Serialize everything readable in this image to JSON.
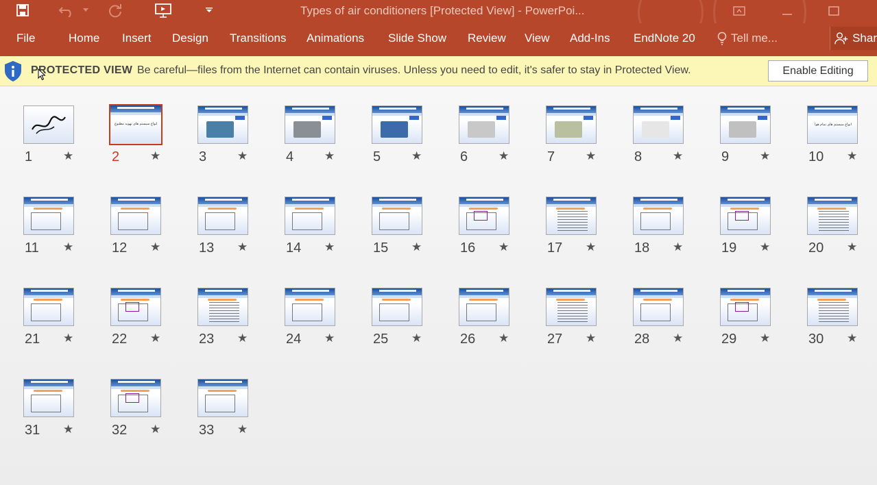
{
  "titlebar": {
    "title": "Types of air conditioners [Protected View] - PowerPoi...",
    "icons": [
      "save-icon",
      "undo-icon",
      "undo-dropdown-icon",
      "redo-icon",
      "from-beginning-icon",
      "customize-qat-icon",
      "restore-ribbon-icon",
      "minimize-icon",
      "maximize-icon"
    ]
  },
  "ribbon": {
    "tabs": [
      "File",
      "Home",
      "Insert",
      "Design",
      "Transitions",
      "Animations",
      "Slide Show",
      "Review",
      "View",
      "Add-Ins",
      "EndNote 20"
    ],
    "tell_me": "Tell me...",
    "share": "Shar"
  },
  "protected_view": {
    "title": "PROTECTED VIEW",
    "message": "Be careful—files from the Internet can contain viruses. Unless you need to edit, it's safer to stay in Protected View.",
    "button": "Enable Editing"
  },
  "slides": {
    "selected": 2,
    "numbers": [
      "1",
      "2",
      "3",
      "4",
      "5",
      "6",
      "7",
      "8",
      "9",
      "10",
      "11",
      "12",
      "13",
      "14",
      "15",
      "16",
      "17",
      "18",
      "19",
      "20",
      "21",
      "22",
      "23",
      "24",
      "25",
      "26",
      "27",
      "28",
      "29",
      "30",
      "31",
      "32",
      "33"
    ],
    "star_glyph": "★",
    "slide2_text": "انواع سیستم های تهویه مطبوع",
    "slide10_text": "انواع سیستم های تمام هوا"
  },
  "colors": {
    "brand": "#b7472a",
    "selection": "#c43e1c",
    "protected_bg": "#fcf7b6"
  }
}
